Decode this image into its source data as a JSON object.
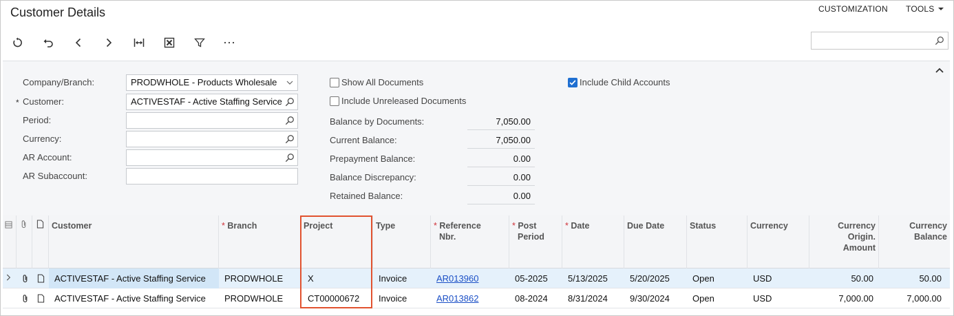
{
  "header": {
    "title": "Customer Details",
    "menu": [
      "CUSTOMIZATION",
      "TOOLS"
    ]
  },
  "toolbar": {
    "buttons": [
      "refresh-icon",
      "undo-icon",
      "previous-icon",
      "next-icon",
      "fit-columns-icon",
      "excel-export-icon",
      "filter-icon",
      "more-icon"
    ],
    "search_placeholder": ""
  },
  "form": {
    "company_branch": {
      "label": "Company/Branch:",
      "value": "PRODWHOLE - Products Wholesale"
    },
    "customer": {
      "label": "Customer:",
      "value": "ACTIVESTAF - Active Staffing Service",
      "required_mark": "*"
    },
    "period": {
      "label": "Period:",
      "value": ""
    },
    "currency": {
      "label": "Currency:",
      "value": ""
    },
    "ar_account": {
      "label": "AR Account:",
      "value": ""
    },
    "ar_subaccount": {
      "label": "AR Subaccount:",
      "value": ""
    },
    "show_all_documents": {
      "label": "Show All Documents",
      "checked": false
    },
    "include_unreleased": {
      "label": "Include Unreleased Documents",
      "checked": false
    },
    "include_child_accounts": {
      "label": "Include Child Accounts",
      "checked": true
    },
    "balances": [
      {
        "label": "Balance by Documents:",
        "value": "7,050.00"
      },
      {
        "label": "Current Balance:",
        "value": "7,050.00"
      },
      {
        "label": "Prepayment Balance:",
        "value": "0.00"
      },
      {
        "label": "Balance Discrepancy:",
        "value": "0.00"
      },
      {
        "label": "Retained Balance:",
        "value": "0.00"
      }
    ]
  },
  "grid": {
    "columns": [
      {
        "label": "Customer",
        "required": false
      },
      {
        "label": "Branch",
        "required": true
      },
      {
        "label": "Project",
        "required": false
      },
      {
        "label": "Type",
        "required": false
      },
      {
        "label": "Reference Nbr.",
        "required": true
      },
      {
        "label": "Post Period",
        "required": true
      },
      {
        "label": "Date",
        "required": true
      },
      {
        "label": "Due Date",
        "required": false
      },
      {
        "label": "Status",
        "required": false
      },
      {
        "label": "Currency",
        "required": false
      },
      {
        "label": "Currency Origin. Amount",
        "required": false
      },
      {
        "label": "Currency Balance",
        "required": false
      }
    ],
    "header_lines": {
      "reference_1": "Reference",
      "reference_2": "Nbr.",
      "post_1": "Post",
      "post_2": "Period",
      "orig_1": "Currency",
      "orig_2": "Origin.",
      "orig_3": "Amount",
      "bal_1": "Currency",
      "bal_2": "Balance"
    },
    "rows": [
      {
        "customer": "ACTIVESTAF - Active Staffing Service",
        "branch": "PRODWHOLE",
        "project": "X",
        "type": "Invoice",
        "reference": "AR013960",
        "post_period": "05-2025",
        "date": "5/13/2025",
        "due_date": "5/20/2025",
        "status": "Open",
        "currency": "USD",
        "orig_amount": "50.00",
        "balance": "50.00"
      },
      {
        "customer": "ACTIVESTAF - Active Staffing Service",
        "branch": "PRODWHOLE",
        "project": "CT00000672",
        "type": "Invoice",
        "reference": "AR013862",
        "post_period": "08-2024",
        "date": "8/31/2024",
        "due_date": "9/30/2024",
        "status": "Open",
        "currency": "USD",
        "orig_amount": "7,000.00",
        "balance": "7,000.00"
      }
    ]
  },
  "colors": {
    "accent": "#1f6fd1",
    "highlight": "#e1522f",
    "selected_row": "#e5f1fb",
    "required": "#d0323a"
  }
}
